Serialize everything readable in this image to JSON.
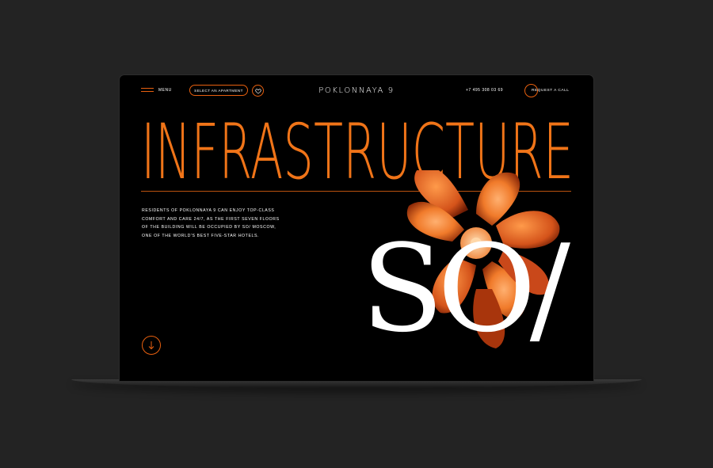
{
  "header": {
    "menu_label": "MENU",
    "select_label": "SELECT AN APARTMENT",
    "logo": "POKLONNAYA 9",
    "phone": "+7 495 308 03 69",
    "request_label": "REQUEST A CALL"
  },
  "hero": {
    "title": "INFRASTRUCTURE",
    "description": "RESIDENTS OF POKLONNAYA 9 CAN ENJOY TOP-CLASS COMFORT AND CARE 24/7, AS THE FIRST SEVEN FLOORS OF THE BUILDING WILL BE OCCUPIED BY SO/ MOSCOW, ONE OF THE WORLD'S BEST FIVE-STAR HOTELS.",
    "brand_mark": "SO/"
  },
  "icons": {
    "menu": "hamburger-icon",
    "favorites": "heart-icon",
    "request": "circle-icon",
    "scroll": "arrow-down-icon"
  },
  "colors": {
    "accent": "#f07418",
    "background": "#000000",
    "page_background": "#232323",
    "text": "#ffffff"
  }
}
